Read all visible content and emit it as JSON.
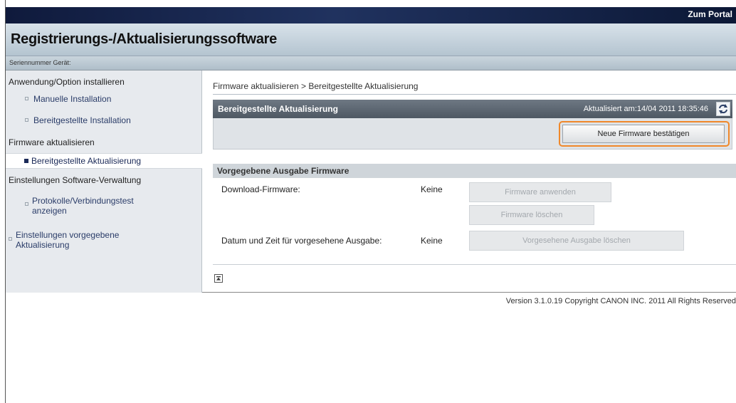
{
  "header": {
    "portal_link": "Zum Portal",
    "title": "Registrierungs-/Aktualisierungssoftware",
    "serial_label": "Seriennummer Gerät:"
  },
  "sidebar": {
    "section1": "Anwendung/Option installieren",
    "manual_install": "Manuelle Installation",
    "provided_install": "Bereitgestellte Installation",
    "section2": "Firmware aktualisieren",
    "provided_update": "Bereitgestellte Aktualisierung",
    "section3": "Einstellungen Software-Verwaltung",
    "logs_line1": "Protokolle/Verbindungstest",
    "logs_line2": "anzeigen",
    "scheduled_line1": "Einstellungen vorgegebene",
    "scheduled_line2": "Aktualisierung"
  },
  "main": {
    "breadcrumb": "Firmware aktualisieren > Bereitgestellte Aktualisierung",
    "panel_title": "Bereitgestellte Aktualisierung",
    "updated_at": "Aktualisiert am:14/04 2011 18:35:46",
    "confirm_button": "Neue Firmware bestätigen",
    "section_title": "Vorgegebene Ausgabe Firmware",
    "download_label": "Download-Firmware:",
    "download_value": "Keine",
    "apply_button": "Firmware anwenden",
    "delete_button": "Firmware löschen",
    "schedule_label": "Datum und Zeit für vorgesehene Ausgabe:",
    "schedule_value": "Keine",
    "delete_schedule_button": "Vorgesehene Ausgabe löschen"
  },
  "footer": {
    "copyright": "Version 3.1.0.19 Copyright CANON INC. 2011 All Rights Reserved"
  },
  "colors": {
    "top_bar": "#1a2a52",
    "highlight": "#f0882a"
  },
  "icons": [
    "refresh-icon",
    "page-top-icon"
  ]
}
